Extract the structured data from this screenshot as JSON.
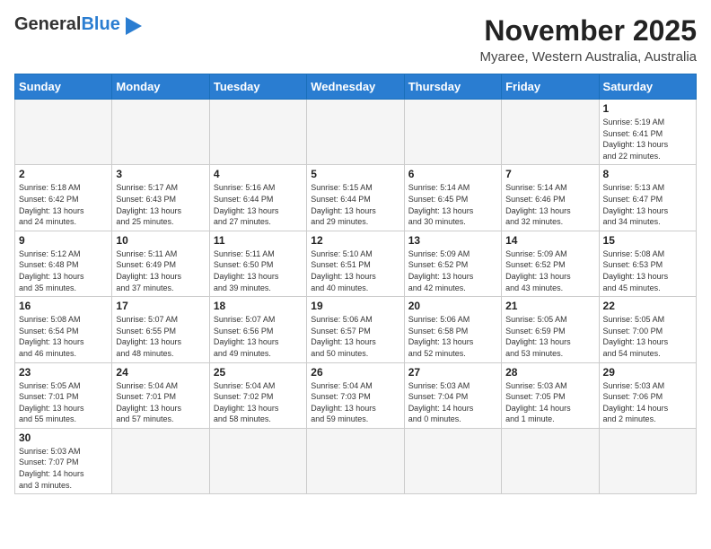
{
  "header": {
    "logo_general": "General",
    "logo_blue": "Blue",
    "month_title": "November 2025",
    "location": "Myaree, Western Australia, Australia"
  },
  "days_of_week": [
    "Sunday",
    "Monday",
    "Tuesday",
    "Wednesday",
    "Thursday",
    "Friday",
    "Saturday"
  ],
  "weeks": [
    [
      {
        "day": "",
        "info": ""
      },
      {
        "day": "",
        "info": ""
      },
      {
        "day": "",
        "info": ""
      },
      {
        "day": "",
        "info": ""
      },
      {
        "day": "",
        "info": ""
      },
      {
        "day": "",
        "info": ""
      },
      {
        "day": "1",
        "info": "Sunrise: 5:19 AM\nSunset: 6:41 PM\nDaylight: 13 hours\nand 22 minutes."
      }
    ],
    [
      {
        "day": "2",
        "info": "Sunrise: 5:18 AM\nSunset: 6:42 PM\nDaylight: 13 hours\nand 24 minutes."
      },
      {
        "day": "3",
        "info": "Sunrise: 5:17 AM\nSunset: 6:43 PM\nDaylight: 13 hours\nand 25 minutes."
      },
      {
        "day": "4",
        "info": "Sunrise: 5:16 AM\nSunset: 6:44 PM\nDaylight: 13 hours\nand 27 minutes."
      },
      {
        "day": "5",
        "info": "Sunrise: 5:15 AM\nSunset: 6:44 PM\nDaylight: 13 hours\nand 29 minutes."
      },
      {
        "day": "6",
        "info": "Sunrise: 5:14 AM\nSunset: 6:45 PM\nDaylight: 13 hours\nand 30 minutes."
      },
      {
        "day": "7",
        "info": "Sunrise: 5:14 AM\nSunset: 6:46 PM\nDaylight: 13 hours\nand 32 minutes."
      },
      {
        "day": "8",
        "info": "Sunrise: 5:13 AM\nSunset: 6:47 PM\nDaylight: 13 hours\nand 34 minutes."
      }
    ],
    [
      {
        "day": "9",
        "info": "Sunrise: 5:12 AM\nSunset: 6:48 PM\nDaylight: 13 hours\nand 35 minutes."
      },
      {
        "day": "10",
        "info": "Sunrise: 5:11 AM\nSunset: 6:49 PM\nDaylight: 13 hours\nand 37 minutes."
      },
      {
        "day": "11",
        "info": "Sunrise: 5:11 AM\nSunset: 6:50 PM\nDaylight: 13 hours\nand 39 minutes."
      },
      {
        "day": "12",
        "info": "Sunrise: 5:10 AM\nSunset: 6:51 PM\nDaylight: 13 hours\nand 40 minutes."
      },
      {
        "day": "13",
        "info": "Sunrise: 5:09 AM\nSunset: 6:52 PM\nDaylight: 13 hours\nand 42 minutes."
      },
      {
        "day": "14",
        "info": "Sunrise: 5:09 AM\nSunset: 6:52 PM\nDaylight: 13 hours\nand 43 minutes."
      },
      {
        "day": "15",
        "info": "Sunrise: 5:08 AM\nSunset: 6:53 PM\nDaylight: 13 hours\nand 45 minutes."
      }
    ],
    [
      {
        "day": "16",
        "info": "Sunrise: 5:08 AM\nSunset: 6:54 PM\nDaylight: 13 hours\nand 46 minutes."
      },
      {
        "day": "17",
        "info": "Sunrise: 5:07 AM\nSunset: 6:55 PM\nDaylight: 13 hours\nand 48 minutes."
      },
      {
        "day": "18",
        "info": "Sunrise: 5:07 AM\nSunset: 6:56 PM\nDaylight: 13 hours\nand 49 minutes."
      },
      {
        "day": "19",
        "info": "Sunrise: 5:06 AM\nSunset: 6:57 PM\nDaylight: 13 hours\nand 50 minutes."
      },
      {
        "day": "20",
        "info": "Sunrise: 5:06 AM\nSunset: 6:58 PM\nDaylight: 13 hours\nand 52 minutes."
      },
      {
        "day": "21",
        "info": "Sunrise: 5:05 AM\nSunset: 6:59 PM\nDaylight: 13 hours\nand 53 minutes."
      },
      {
        "day": "22",
        "info": "Sunrise: 5:05 AM\nSunset: 7:00 PM\nDaylight: 13 hours\nand 54 minutes."
      }
    ],
    [
      {
        "day": "23",
        "info": "Sunrise: 5:05 AM\nSunset: 7:01 PM\nDaylight: 13 hours\nand 55 minutes."
      },
      {
        "day": "24",
        "info": "Sunrise: 5:04 AM\nSunset: 7:01 PM\nDaylight: 13 hours\nand 57 minutes."
      },
      {
        "day": "25",
        "info": "Sunrise: 5:04 AM\nSunset: 7:02 PM\nDaylight: 13 hours\nand 58 minutes."
      },
      {
        "day": "26",
        "info": "Sunrise: 5:04 AM\nSunset: 7:03 PM\nDaylight: 13 hours\nand 59 minutes."
      },
      {
        "day": "27",
        "info": "Sunrise: 5:03 AM\nSunset: 7:04 PM\nDaylight: 14 hours\nand 0 minutes."
      },
      {
        "day": "28",
        "info": "Sunrise: 5:03 AM\nSunset: 7:05 PM\nDaylight: 14 hours\nand 1 minute."
      },
      {
        "day": "29",
        "info": "Sunrise: 5:03 AM\nSunset: 7:06 PM\nDaylight: 14 hours\nand 2 minutes."
      }
    ],
    [
      {
        "day": "30",
        "info": "Sunrise: 5:03 AM\nSunset: 7:07 PM\nDaylight: 14 hours\nand 3 minutes."
      },
      {
        "day": "",
        "info": ""
      },
      {
        "day": "",
        "info": ""
      },
      {
        "day": "",
        "info": ""
      },
      {
        "day": "",
        "info": ""
      },
      {
        "day": "",
        "info": ""
      },
      {
        "day": "",
        "info": ""
      }
    ]
  ]
}
